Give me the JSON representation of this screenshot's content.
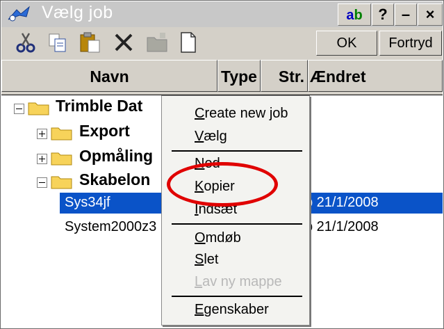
{
  "window": {
    "title": "Vælg job",
    "ab_a": "a",
    "ab_b": "b",
    "help_label": "?",
    "minimize_label": "–",
    "close_label": "×"
  },
  "toolbar": {
    "ok_label": "OK",
    "cancel_label": "Fortryd",
    "icons": [
      "cut-icon",
      "copy-icon",
      "paste-icon",
      "delete-icon",
      "new-folder-icon",
      "new-file-icon"
    ]
  },
  "columns": {
    "name": "Navn",
    "type": "Type",
    "size": "Str.",
    "modified": "Ændret"
  },
  "tree": {
    "root": "Trimble Dat",
    "items": [
      {
        "label": "Export",
        "expanded": false
      },
      {
        "label": "Opmåling",
        "expanded": false
      },
      {
        "label": "Skabelon",
        "expanded": true
      }
    ],
    "files": [
      {
        "name": "Sys34jf",
        "modified": "b 21/1/2008",
        "selected": true
      },
      {
        "name": "System2000z3",
        "modified": "b 21/1/2008",
        "selected": false
      }
    ]
  },
  "context_menu": {
    "create_prefix": "C",
    "create_rest": "reate new job",
    "select_prefix": "V",
    "select_rest": "ælg",
    "down_prefix": "N",
    "down_rest": "ed",
    "copy_prefix": "K",
    "copy_rest": "opier",
    "paste_prefix": "I",
    "paste_rest": "ndsæt",
    "rename_prefix": "O",
    "rename_rest": "mdøb",
    "delete_prefix": "S",
    "delete_rest": "let",
    "newfolder_prefix": "L",
    "newfolder_rest": "av ny mappe",
    "properties_prefix": "E",
    "properties_rest": "genskaber"
  },
  "colors": {
    "selection": "#0a53c8",
    "highlight_circle": "#e00000",
    "titlebar": "#c8c8c8",
    "face": "#d4d0c8"
  }
}
